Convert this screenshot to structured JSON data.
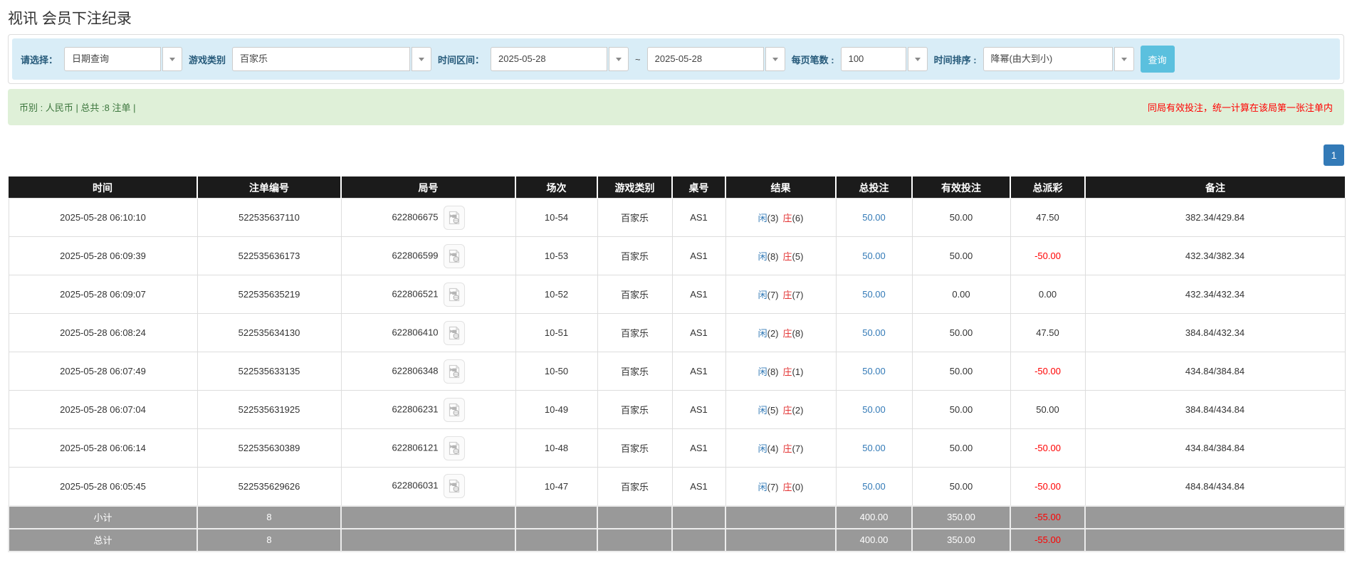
{
  "page": {
    "title": "视讯 会员下注纪录"
  },
  "colors": {
    "accent_button": "#5bc0de",
    "pager_blue": "#337ab7",
    "link_blue": "#337ab7",
    "player_blue": "#337ab7",
    "banker_red": "#e33333",
    "negative_red": "#ff0000",
    "summary_bg": "#dff0d8",
    "summary_text": "#3c763d",
    "filter_bg": "#d9edf7",
    "header_bg": "#1b1b1b",
    "footer_bg": "#999999"
  },
  "filters": {
    "select_type": {
      "label": "请选择：",
      "value": "日期查询"
    },
    "game_category": {
      "label": "游戏类别",
      "value": "百家乐"
    },
    "time_range": {
      "label": "时间区间：",
      "from": "2025-05-28",
      "separator": "~",
      "to": "2025-05-28"
    },
    "page_size": {
      "label": "每页笔数 :",
      "value": "100"
    },
    "time_sort": {
      "label": "时间排序 :",
      "value": "降幂(由大到小)"
    },
    "search_button": "查询"
  },
  "summary": {
    "left": "币别 : 人民币 | 总共 :8 注单 |",
    "right": "同局有效投注，统一计算在该局第一张注单内"
  },
  "pagination": {
    "current_page": "1"
  },
  "table": {
    "columns": [
      "时间",
      "注单编号",
      "局号",
      "场次",
      "游戏类别",
      "桌号",
      "结果",
      "总投注",
      "有效投注",
      "总派彩",
      "备注"
    ],
    "result_labels": {
      "player": "闲",
      "banker": "庄"
    },
    "rows": [
      {
        "time": "2025-05-28 06:10:10",
        "bet_id": "522535637110",
        "round_id": "622806675",
        "session": "10-54",
        "game": "百家乐",
        "table_no": "AS1",
        "result": {
          "player": "3",
          "banker": "6"
        },
        "total_bet": "50.00",
        "valid_bet": "50.00",
        "payout": "47.50",
        "note": "382.34/429.84"
      },
      {
        "time": "2025-05-28 06:09:39",
        "bet_id": "522535636173",
        "round_id": "622806599",
        "session": "10-53",
        "game": "百家乐",
        "table_no": "AS1",
        "result": {
          "player": "8",
          "banker": "5"
        },
        "total_bet": "50.00",
        "valid_bet": "50.00",
        "payout": "-50.00",
        "note": "432.34/382.34"
      },
      {
        "time": "2025-05-28 06:09:07",
        "bet_id": "522535635219",
        "round_id": "622806521",
        "session": "10-52",
        "game": "百家乐",
        "table_no": "AS1",
        "result": {
          "player": "7",
          "banker": "7"
        },
        "total_bet": "50.00",
        "valid_bet": "0.00",
        "payout": "0.00",
        "note": "432.34/432.34"
      },
      {
        "time": "2025-05-28 06:08:24",
        "bet_id": "522535634130",
        "round_id": "622806410",
        "session": "10-51",
        "game": "百家乐",
        "table_no": "AS1",
        "result": {
          "player": "2",
          "banker": "8"
        },
        "total_bet": "50.00",
        "valid_bet": "50.00",
        "payout": "47.50",
        "note": "384.84/432.34"
      },
      {
        "time": "2025-05-28 06:07:49",
        "bet_id": "522535633135",
        "round_id": "622806348",
        "session": "10-50",
        "game": "百家乐",
        "table_no": "AS1",
        "result": {
          "player": "8",
          "banker": "1"
        },
        "total_bet": "50.00",
        "valid_bet": "50.00",
        "payout": "-50.00",
        "note": "434.84/384.84"
      },
      {
        "time": "2025-05-28 06:07:04",
        "bet_id": "522535631925",
        "round_id": "622806231",
        "session": "10-49",
        "game": "百家乐",
        "table_no": "AS1",
        "result": {
          "player": "5",
          "banker": "2"
        },
        "total_bet": "50.00",
        "valid_bet": "50.00",
        "payout": "50.00",
        "note": "384.84/434.84"
      },
      {
        "time": "2025-05-28 06:06:14",
        "bet_id": "522535630389",
        "round_id": "622806121",
        "session": "10-48",
        "game": "百家乐",
        "table_no": "AS1",
        "result": {
          "player": "4",
          "banker": "7"
        },
        "total_bet": "50.00",
        "valid_bet": "50.00",
        "payout": "-50.00",
        "note": "434.84/384.84"
      },
      {
        "time": "2025-05-28 06:05:45",
        "bet_id": "522535629626",
        "round_id": "622806031",
        "session": "10-47",
        "game": "百家乐",
        "table_no": "AS1",
        "result": {
          "player": "7",
          "banker": "0"
        },
        "total_bet": "50.00",
        "valid_bet": "50.00",
        "payout": "-50.00",
        "note": "484.84/434.84"
      }
    ],
    "subtotal": {
      "label": "小计",
      "count": "8",
      "total_bet": "400.00",
      "valid_bet": "350.00",
      "payout": "-55.00"
    },
    "total": {
      "label": "总计",
      "count": "8",
      "total_bet": "400.00",
      "valid_bet": "350.00",
      "payout": "-55.00"
    }
  }
}
